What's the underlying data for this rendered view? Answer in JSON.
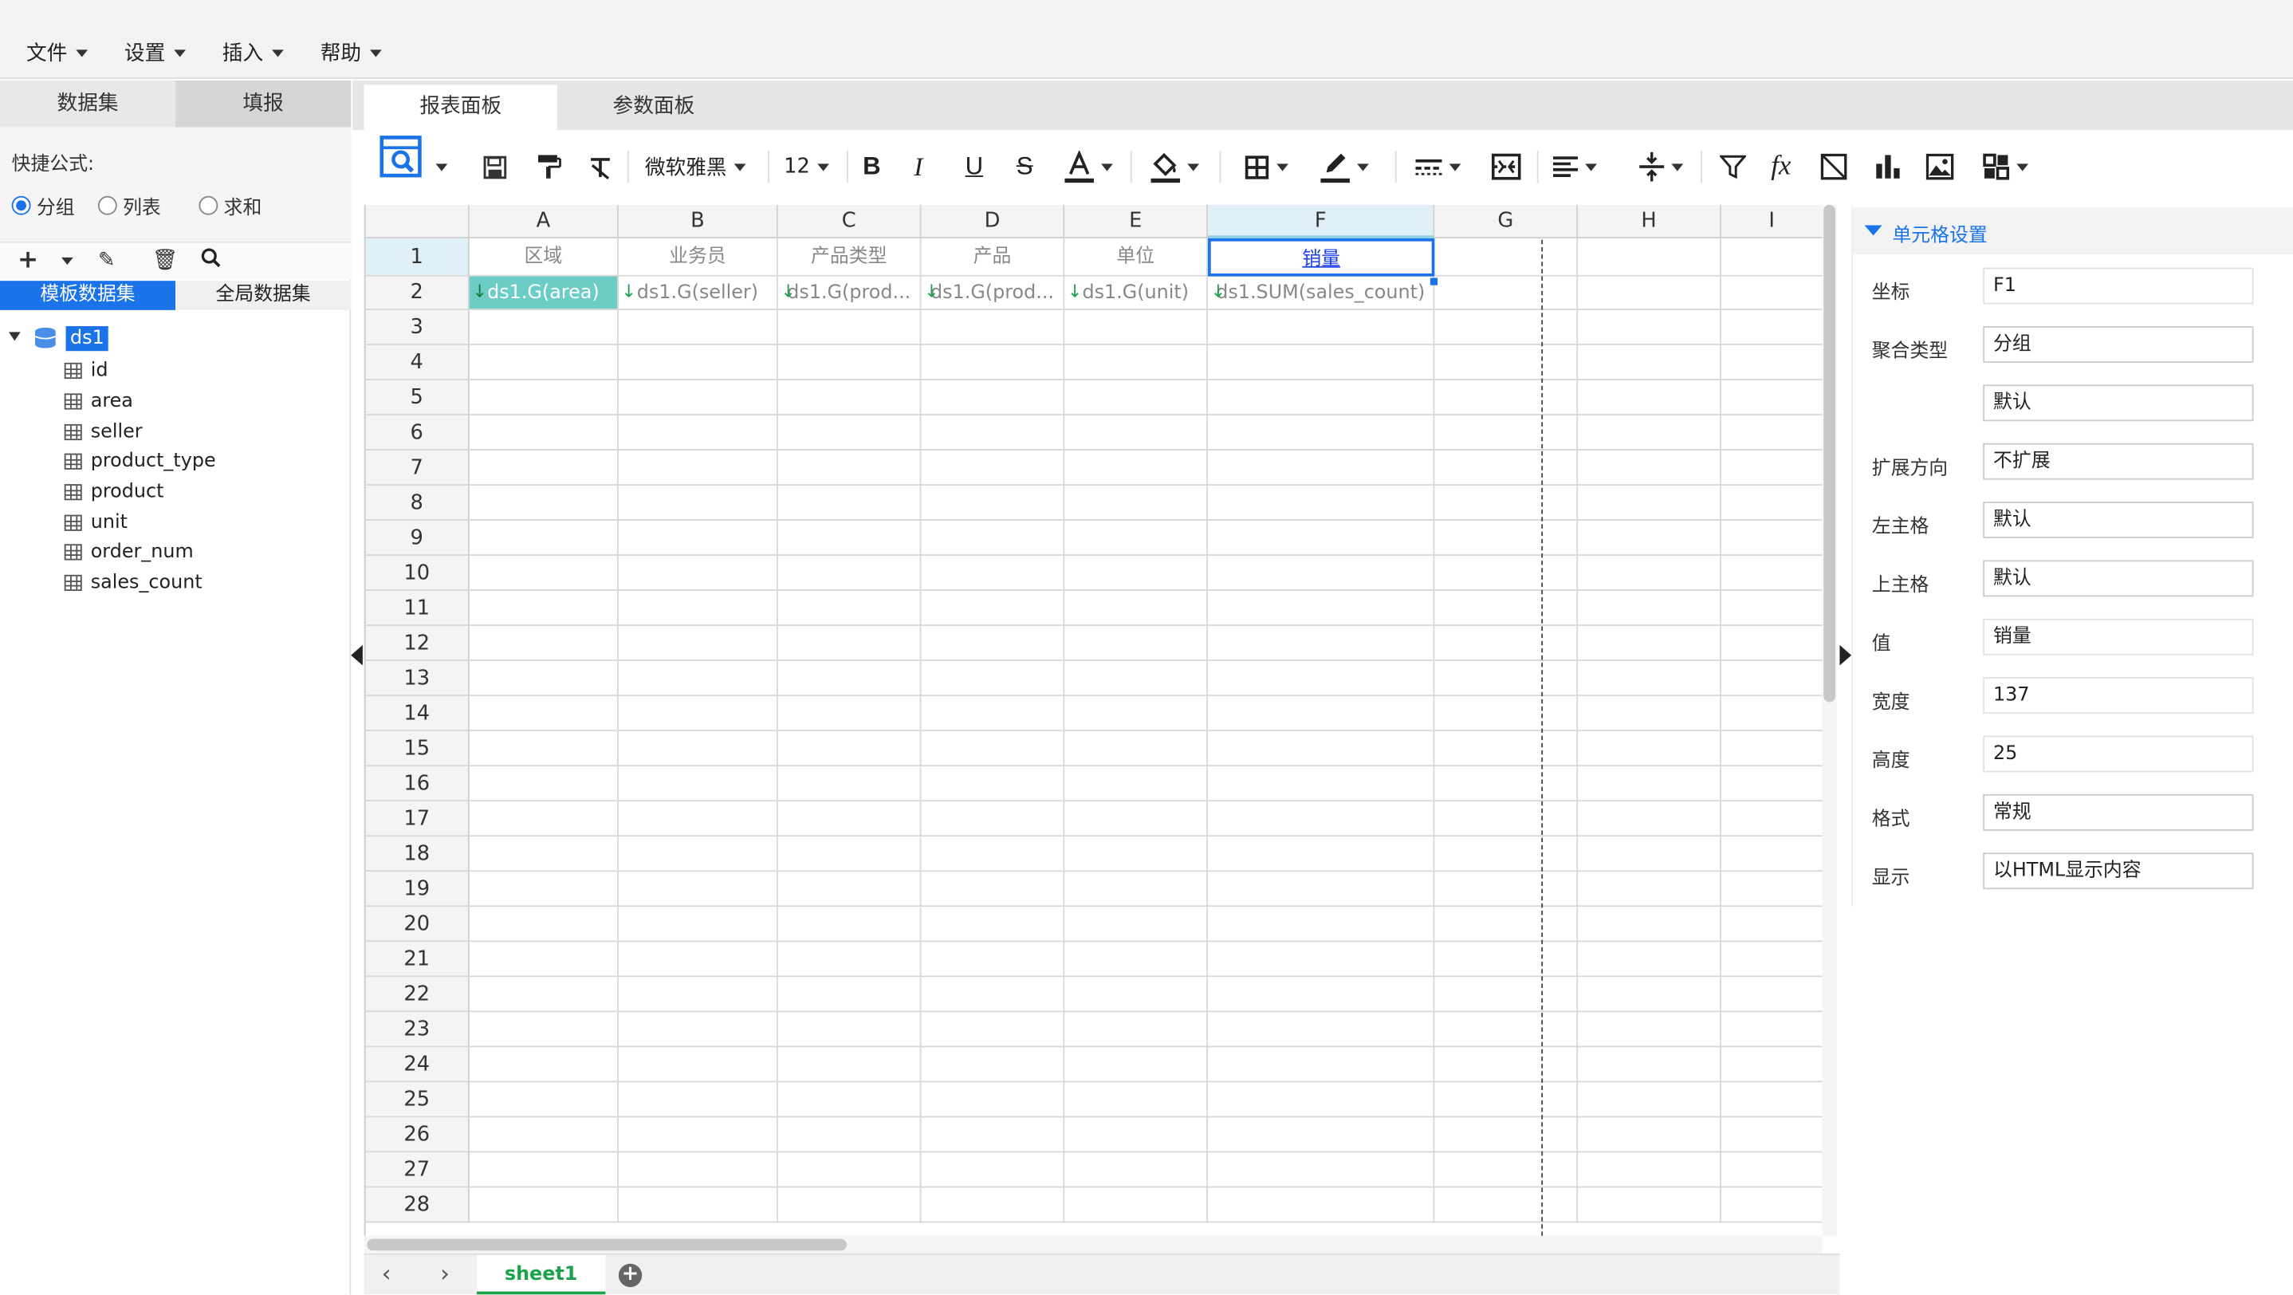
{
  "menubar": {
    "items": [
      "文件",
      "设置",
      "插入",
      "帮助"
    ]
  },
  "left": {
    "tabs": [
      "数据集",
      "填报"
    ],
    "quick_formula_label": "快捷公式:",
    "radios": [
      {
        "label": "分组",
        "checked": true
      },
      {
        "label": "列表",
        "checked": false
      },
      {
        "label": "求和",
        "checked": false
      }
    ],
    "subtabs": [
      "模板数据集",
      "全局数据集"
    ],
    "tree_root": "ds1",
    "fields": [
      "id",
      "area",
      "seller",
      "product_type",
      "product",
      "unit",
      "order_num",
      "sales_count"
    ]
  },
  "main": {
    "tabs": [
      "报表面板",
      "参数面板"
    ],
    "toolbar": {
      "font": "微软雅黑",
      "size": "12"
    }
  },
  "grid": {
    "columns": [
      "A",
      "B",
      "C",
      "D",
      "E",
      "F",
      "G",
      "H",
      "I"
    ],
    "selected_column": "F",
    "row_numbers": [
      "1",
      "2",
      "3",
      "4",
      "5",
      "6",
      "7",
      "8",
      "9",
      "10",
      "11",
      "12",
      "13",
      "14",
      "15",
      "16",
      "17",
      "18",
      "19",
      "20",
      "21",
      "22",
      "23",
      "24",
      "25",
      "26",
      "27",
      "28"
    ],
    "row1": [
      "区域",
      "业务员",
      "产品类型",
      "产品",
      "单位",
      "销量"
    ],
    "row2": [
      "ds1.G(area)",
      "ds1.G(seller)",
      "ds1.G(prod...",
      "ds1.G(prod...",
      "ds1.G(unit)",
      "ds1.SUM(sales_count)"
    ]
  },
  "panel": {
    "title": "单元格设置",
    "rows": [
      {
        "label": "坐标",
        "value": "F1"
      },
      {
        "label": "聚合类型",
        "value": "分组"
      },
      {
        "label": "",
        "value": "默认"
      },
      {
        "label": "扩展方向",
        "value": "不扩展"
      },
      {
        "label": "左主格",
        "value": "默认"
      },
      {
        "label": "上主格",
        "value": "默认"
      },
      {
        "label": "值",
        "value": "销量"
      },
      {
        "label": "宽度",
        "value": "137"
      },
      {
        "label": "高度",
        "value": "25"
      },
      {
        "label": "格式",
        "value": "常规"
      },
      {
        "label": "显示",
        "value": "以HTML显示内容"
      }
    ]
  },
  "sheets": {
    "active": "sheet1"
  },
  "colors": {
    "accent": "#1a73e8",
    "selected_cell": "#6ccdc6",
    "arrow": "#1aa34a"
  }
}
